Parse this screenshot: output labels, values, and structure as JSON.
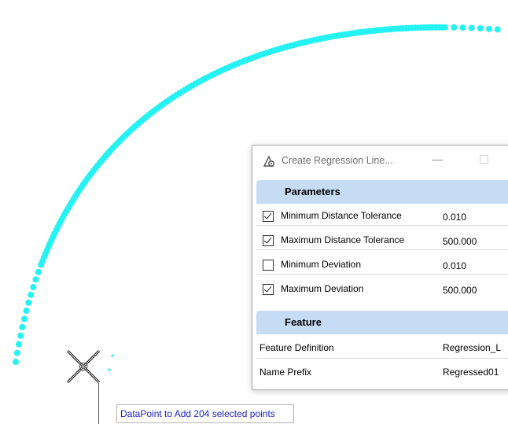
{
  "viewport": {
    "point_color": "#25f2f2",
    "points_count_label": "204"
  },
  "dialog": {
    "title": "Create Regression Line...",
    "icon": "regression-tool-icon",
    "minimize_glyph": "—",
    "sections": {
      "parameters": "Parameters",
      "feature": "Feature"
    },
    "parameters": [
      {
        "checked": true,
        "label": "Minimum Distance Tolerance",
        "value": "0.010"
      },
      {
        "checked": true,
        "label": "Maximum Distance Tolerance",
        "value": "500.000"
      },
      {
        "checked": false,
        "label": "Minimum Deviation",
        "value": "0.010"
      },
      {
        "checked": true,
        "label": "Maximum Deviation",
        "value": "500.000"
      }
    ],
    "feature": [
      {
        "label": "Feature Definition",
        "value": "Regression_L"
      },
      {
        "label": "Name Prefix",
        "value": "Regressed01"
      }
    ],
    "section_bg": "#c6dcf4"
  },
  "tooltip": {
    "text": "DataPoint to Add 204 selected points",
    "color": "#1a24c8"
  }
}
